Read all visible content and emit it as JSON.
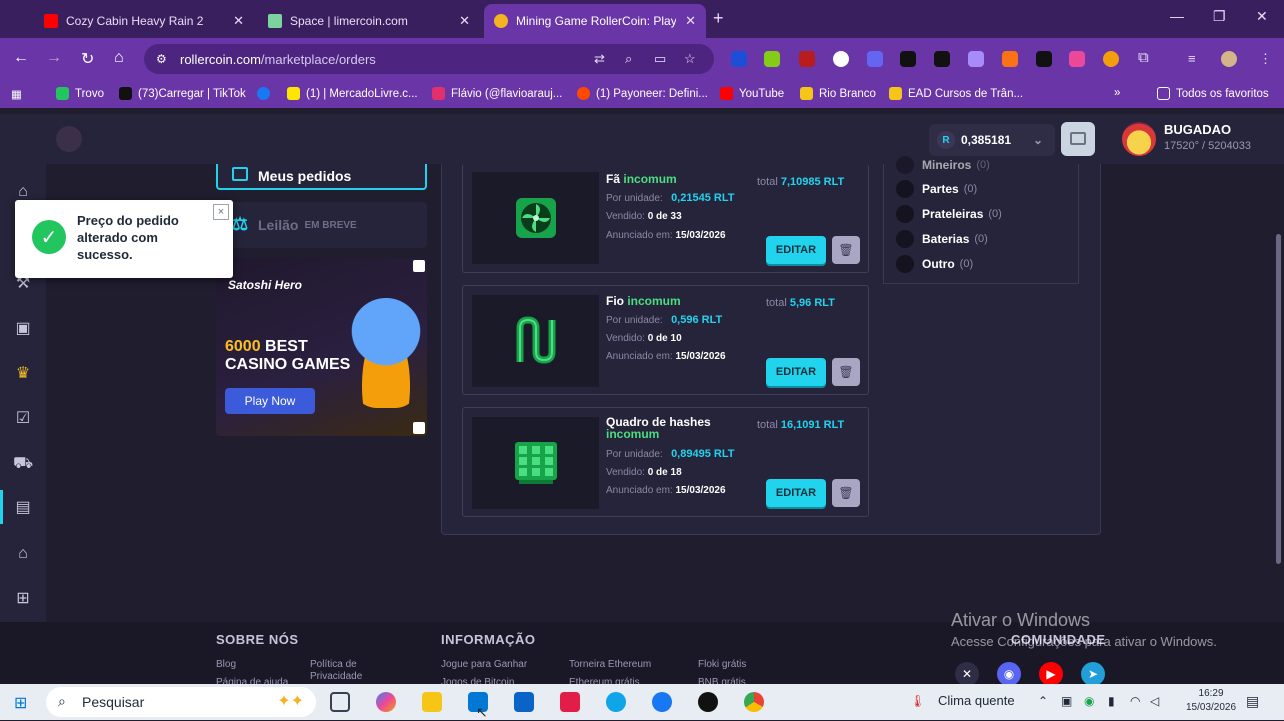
{
  "browser": {
    "tabs": [
      {
        "title": "Cozy Cabin Heavy Rain 2",
        "favicon_color": "#ff0000"
      },
      {
        "title": "Space | limercoin.com",
        "favicon_color": "#7dd3a0"
      },
      {
        "title": "Mining Game RollerCoin: Play f",
        "favicon_color": "#f5b324"
      }
    ],
    "url_host": "rollercoin.com",
    "url_path": "/marketplace/orders",
    "bookmarks": [
      {
        "label": "Trovo",
        "color": "#22c55e"
      },
      {
        "label": "(73)Carregar | TikTok",
        "color": "#111111"
      },
      {
        "label": "",
        "color": "#1877f2"
      },
      {
        "label": "(1) | MercadoLivre.c...",
        "color": "#ffe600"
      },
      {
        "label": "Flávio (@flavioarauj...",
        "color": "#e1306c"
      },
      {
        "label": "(1) Payoneer: Defini...",
        "color": "#ff4800"
      },
      {
        "label": "YouTube",
        "color": "#ff0000"
      },
      {
        "label": "Rio Branco",
        "color": "#f5c518"
      },
      {
        "label": "EAD Cursos de Trân...",
        "color": "#f5c518"
      }
    ],
    "all_bookmarks_label": "Todos os favoritos"
  },
  "header": {
    "balance": "0,385181",
    "currency_badge": "R",
    "username": "BUGADAO",
    "power": "17520° / 5204033"
  },
  "sidebar_menu": {
    "my_orders": "Meus pedidos",
    "auction": "Leilão",
    "auction_badge": "EM BREVE"
  },
  "ad": {
    "brand": "Satoshi Hero",
    "line1_accent": "6000",
    "line1_rest": " BEST",
    "line2": "CASINO GAMES",
    "cta": "Play Now"
  },
  "toast": {
    "message": "Preço do pedido alterado com sucesso.",
    "close": "×"
  },
  "orders": [
    {
      "name": "Fã",
      "rarity": "incomum",
      "unit_label": "Por unidade:",
      "unit_price": "0,21545 RLT",
      "sold_label": "Vendido:",
      "sold": "0 de 33",
      "listed_label": "Anunciado em:",
      "listed": "15/03/2026",
      "total_label": "total",
      "total": "7,10985 RLT",
      "edit": "EDITAR"
    },
    {
      "name": "Fio",
      "rarity": "incomum",
      "unit_label": "Por unidade:",
      "unit_price": "0,596 RLT",
      "sold_label": "Vendido:",
      "sold": "0 de 10",
      "listed_label": "Anunciado em:",
      "listed": "15/03/2026",
      "total_label": "total",
      "total": "5,96 RLT",
      "edit": "EDITAR"
    },
    {
      "name": "Quadro de hashes",
      "rarity": "incomum",
      "unit_label": "Por unidade:",
      "unit_price": "0,89495 RLT",
      "sold_label": "Vendido:",
      "sold": "0 de 18",
      "listed_label": "Anunciado em:",
      "listed": "15/03/2026",
      "total_label": "total",
      "total": "16,1091 RLT",
      "edit": "EDITAR"
    }
  ],
  "filters": [
    {
      "label": "Mineiros",
      "count": "(0)"
    },
    {
      "label": "Partes",
      "count": "(0)"
    },
    {
      "label": "Prateleiras",
      "count": "(0)"
    },
    {
      "label": "Baterias",
      "count": "(0)"
    },
    {
      "label": "Outro",
      "count": "(0)"
    }
  ],
  "footer": {
    "about_title": "SOBRE NÓS",
    "info_title": "INFORMAÇÃO",
    "community_title": "COMUNIDADE",
    "links": [
      "Blog",
      "Política de Privacidade",
      "Jogue para Ganhar",
      "Torneira Ethereum",
      "Floki grátis",
      "Página de ajuda",
      "Jogos de Bitcoin",
      "Ethereum grátis",
      "BNB grátis"
    ]
  },
  "windows_activation": {
    "title": "Ativar o Windows",
    "subtitle": "Acesse Configurações para ativar o Windows."
  },
  "taskbar": {
    "search_placeholder": "Pesquisar",
    "weather": "Clima quente",
    "time": "16:29",
    "date": "15/03/2026"
  }
}
